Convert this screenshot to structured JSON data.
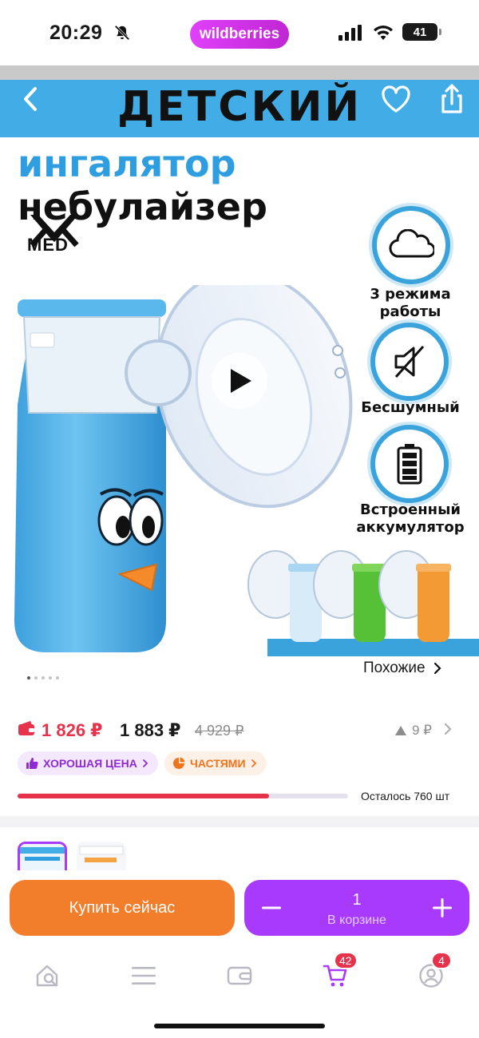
{
  "status_bar": {
    "time": "20:29",
    "app_badge": "wildberries",
    "battery": "41",
    "icons": [
      "bell-off-icon",
      "signal-icon",
      "wifi-icon",
      "battery-icon"
    ]
  },
  "gallery": {
    "headline_1": "ДЕТСКИЙ",
    "headline_2a": "ингалятор",
    "headline_2b": "небулайзер",
    "brand_logo_text": "MED",
    "features": [
      {
        "label_1": "3 режима",
        "label_2": "работы",
        "icon": "cloud-icon"
      },
      {
        "label_1": "Бесшумный",
        "label_2": "",
        "icon": "mute-icon"
      },
      {
        "label_1": "Встроенный",
        "label_2": "аккумулятор",
        "icon": "battery-full-icon"
      }
    ],
    "similar_label": "Похожие",
    "dots_total": 5,
    "dots_active_index": 0,
    "colors": {
      "band": "#41ace6",
      "accent_blue": "#2f9ee0"
    }
  },
  "price": {
    "wallet_price": "1 826 ₽",
    "price": "1 883 ₽",
    "old_price": "4 929 ₽",
    "change": "9 ₽",
    "badge_good_price": "ХОРОШАЯ ЦЕНА",
    "badge_installments": "ЧАСТЯМИ",
    "stock_text": "Осталось 760 шт",
    "stock_progress_fraction": 0.76,
    "colors": {
      "wallet": "#e6324b",
      "purple": "#8e2ad6",
      "orange": "#f0741c"
    }
  },
  "actions": {
    "buy_now": "Купить сейчас",
    "quantity": "1",
    "in_cart": "В корзине",
    "colors": {
      "buy": "#f27d2a",
      "cart": "#a73afd"
    }
  },
  "tab_bar": {
    "tabs": [
      {
        "name": "home",
        "icon": "search-home-icon"
      },
      {
        "name": "catalog",
        "icon": "menu-icon"
      },
      {
        "name": "wallet",
        "icon": "wallet-icon"
      },
      {
        "name": "cart",
        "icon": "cart-icon",
        "badge": "42"
      },
      {
        "name": "profile",
        "icon": "profile-icon",
        "badge": "4"
      }
    ]
  }
}
